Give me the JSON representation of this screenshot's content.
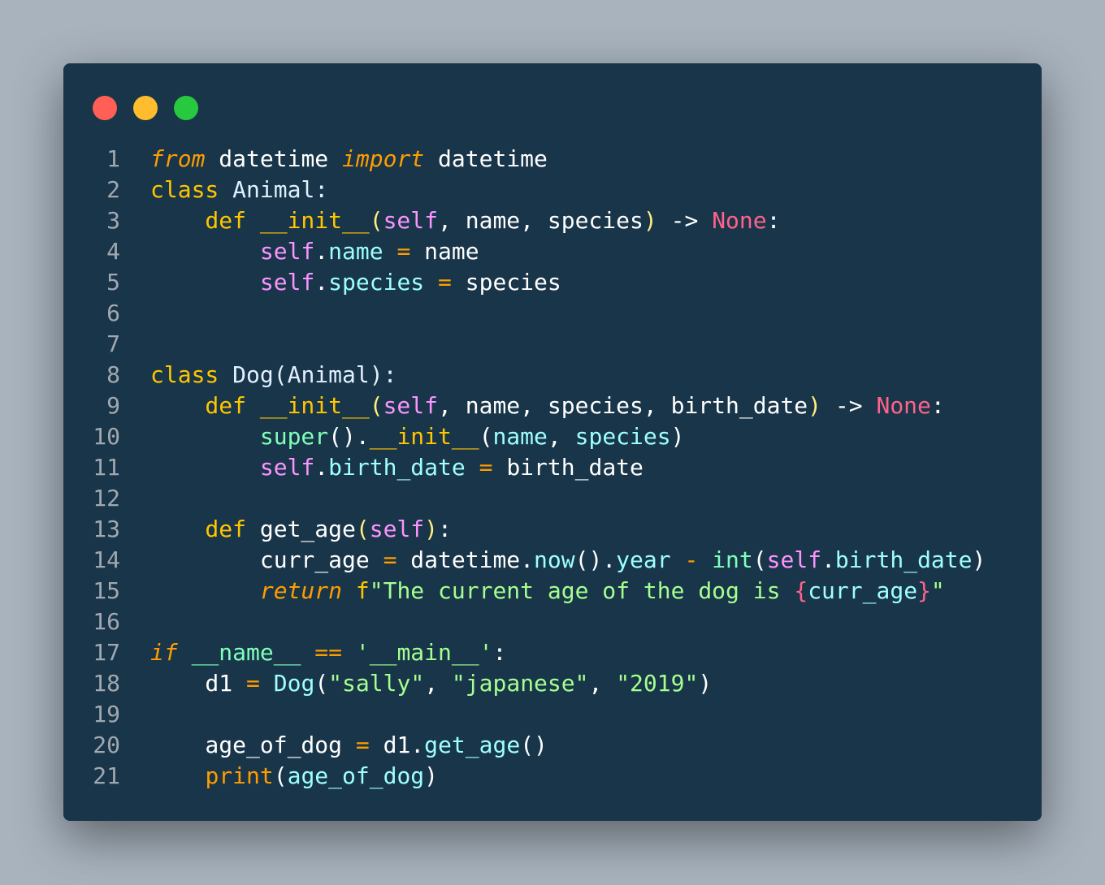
{
  "window": {
    "controls": [
      {
        "name": "close",
        "color": "#ff5f56"
      },
      {
        "name": "minimize",
        "color": "#ffbd2e"
      },
      {
        "name": "maximize",
        "color": "#27c93f"
      }
    ]
  },
  "code": {
    "lines": [
      [
        [
          "from",
          "k"
        ],
        [
          " datetime ",
          "t"
        ],
        [
          "import",
          "k"
        ],
        [
          " datetime",
          "t"
        ]
      ],
      [
        [
          "class",
          "d"
        ],
        [
          " Animal:",
          "w"
        ]
      ],
      [
        [
          "    def ",
          "d"
        ],
        [
          "__init__",
          "f"
        ],
        [
          "(",
          "p"
        ],
        [
          "self",
          "s"
        ],
        [
          ", name, species",
          "t"
        ],
        [
          ")",
          "p"
        ],
        [
          " -> ",
          "t"
        ],
        [
          "None",
          "n"
        ],
        [
          ":",
          "t"
        ]
      ],
      [
        [
          "        ",
          " t"
        ],
        [
          "self",
          "s"
        ],
        [
          ".",
          "t"
        ],
        [
          "name",
          "a"
        ],
        [
          " = ",
          "o"
        ],
        [
          "name",
          "t"
        ]
      ],
      [
        [
          "        ",
          "t"
        ],
        [
          "self",
          "s"
        ],
        [
          ".",
          "t"
        ],
        [
          "species",
          "a"
        ],
        [
          " = ",
          "o"
        ],
        [
          "species",
          "t"
        ]
      ],
      [],
      [],
      [
        [
          "class",
          "d"
        ],
        [
          " Dog(Animal):",
          "w"
        ]
      ],
      [
        [
          "    def ",
          "d"
        ],
        [
          "__init__",
          "f"
        ],
        [
          "(",
          "p"
        ],
        [
          "self",
          "s"
        ],
        [
          ", name, species, birth_date",
          "t"
        ],
        [
          ")",
          "p"
        ],
        [
          " -> ",
          "t"
        ],
        [
          "None",
          "n"
        ],
        [
          ":",
          "t"
        ]
      ],
      [
        [
          "        ",
          "t"
        ],
        [
          "super",
          "b"
        ],
        [
          "().",
          "t"
        ],
        [
          "__init__",
          "f"
        ],
        [
          "(",
          "t"
        ],
        [
          "name",
          "a"
        ],
        [
          ", ",
          "t"
        ],
        [
          "species",
          "a"
        ],
        [
          ")",
          "t"
        ]
      ],
      [
        [
          "        ",
          "t"
        ],
        [
          "self",
          "s"
        ],
        [
          ".",
          "t"
        ],
        [
          "birth_date",
          "a"
        ],
        [
          " = ",
          "o"
        ],
        [
          "birth_date",
          "t"
        ]
      ],
      [],
      [
        [
          "    def ",
          "d"
        ],
        [
          "get_age",
          "t"
        ],
        [
          "(",
          "p"
        ],
        [
          "self",
          "s"
        ],
        [
          ")",
          "p"
        ],
        [
          ":",
          "t"
        ]
      ],
      [
        [
          "        curr_age",
          "t"
        ],
        [
          " = ",
          "o"
        ],
        [
          "datetime.",
          "t"
        ],
        [
          "now",
          "a"
        ],
        [
          "().",
          "t"
        ],
        [
          "year",
          "a"
        ],
        [
          " - ",
          "o"
        ],
        [
          "int",
          "b"
        ],
        [
          "(",
          "t"
        ],
        [
          "self",
          "s"
        ],
        [
          ".",
          "t"
        ],
        [
          "birth_date",
          "a"
        ],
        [
          ")",
          "t"
        ]
      ],
      [
        [
          "        ",
          "t"
        ],
        [
          "return",
          "k"
        ],
        [
          " f",
          "d"
        ],
        [
          "\"The current age of the dog is ",
          "g"
        ],
        [
          "{",
          "n"
        ],
        [
          "curr_age",
          "a"
        ],
        [
          "}",
          "n"
        ],
        [
          "\"",
          "g"
        ]
      ],
      [],
      [
        [
          "if",
          "k"
        ],
        [
          " __name__",
          "b"
        ],
        [
          " == ",
          "o"
        ],
        [
          "'__main__'",
          "g"
        ],
        [
          ":",
          "t"
        ]
      ],
      [
        [
          "    d1",
          "t"
        ],
        [
          " = ",
          "o"
        ],
        [
          "Dog",
          "a"
        ],
        [
          "(",
          "t"
        ],
        [
          "\"sally\"",
          "g"
        ],
        [
          ", ",
          "t"
        ],
        [
          "\"japanese\"",
          "g"
        ],
        [
          ", ",
          "t"
        ],
        [
          "\"2019\"",
          "g"
        ],
        [
          ")",
          "t"
        ]
      ],
      [],
      [
        [
          "    age_of_dog",
          "t"
        ],
        [
          " = ",
          "o"
        ],
        [
          "d1.",
          "t"
        ],
        [
          "get_age",
          "a"
        ],
        [
          "()",
          "t"
        ]
      ],
      [
        [
          "    ",
          "t"
        ],
        [
          "print",
          "o"
        ],
        [
          "(",
          "t"
        ],
        [
          "age_of_dog",
          "a"
        ],
        [
          ")",
          "t"
        ]
      ]
    ]
  }
}
